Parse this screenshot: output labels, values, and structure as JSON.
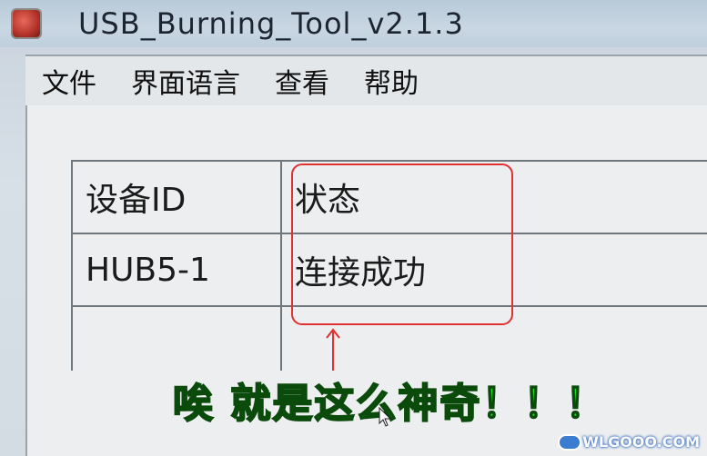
{
  "window": {
    "title": "USB_Burning_Tool_v2.1.3",
    "icon": "app-icon"
  },
  "menu": {
    "items": [
      {
        "label": "文件"
      },
      {
        "label": "界面语言"
      },
      {
        "label": "查看"
      },
      {
        "label": "帮助"
      }
    ]
  },
  "device_table": {
    "headers": {
      "device_id": "设备ID",
      "status": "状态"
    },
    "rows": [
      {
        "device_id": "HUB5-1",
        "status": "连接成功"
      }
    ]
  },
  "annotation": {
    "highlight_color": "#e03030",
    "caption": "唉 就是这么神奇！！！",
    "caption_color": "#22dd22"
  },
  "watermark": {
    "text": "WLGOOO.COM"
  }
}
